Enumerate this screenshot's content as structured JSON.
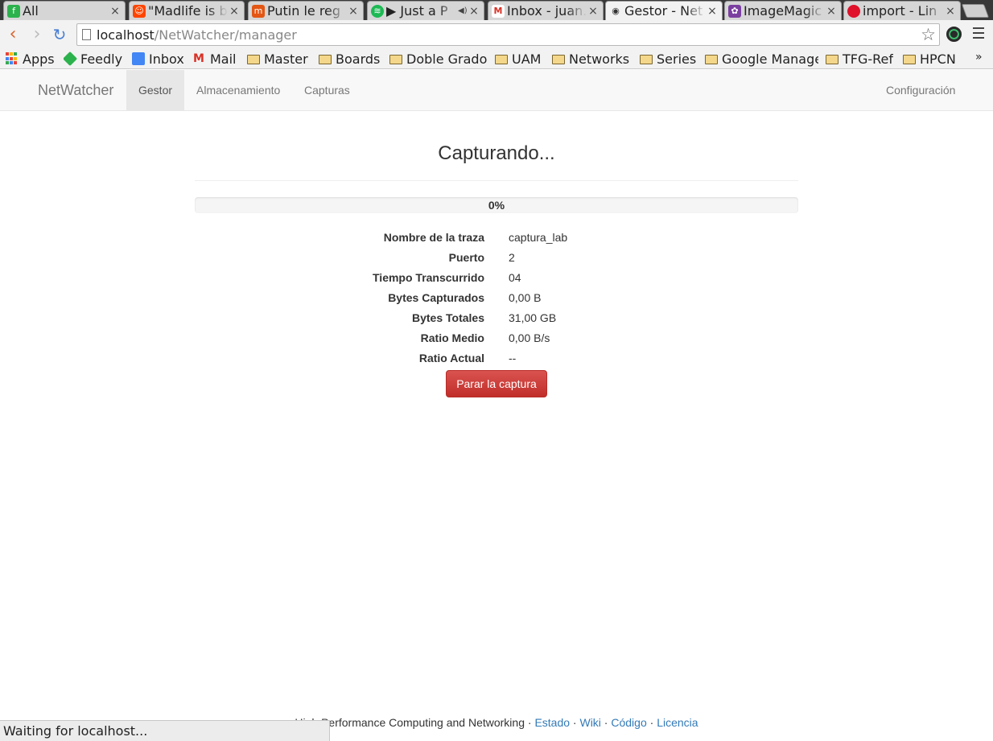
{
  "browser": {
    "tabs": [
      {
        "title": "All",
        "favicon": "feedly-icon",
        "color": "#2bb24c",
        "glyph": "f"
      },
      {
        "title": "\"Madlife is b",
        "favicon": "reddit-icon",
        "color": "#ff4500",
        "glyph": "☺"
      },
      {
        "title": "Putin le reg",
        "favicon": "meneame-icon",
        "color": "#e35614",
        "glyph": "m"
      },
      {
        "title": "▶ Just a P",
        "favicon": "spotify-icon",
        "color": "#1db954",
        "glyph": "≋"
      },
      {
        "title": "Inbox - juan.",
        "favicon": "gmail-icon",
        "color": "#d93025",
        "glyph": "M"
      },
      {
        "title": "Gestor - Net",
        "favicon": "eye-icon",
        "color": "#555555",
        "glyph": "◉"
      },
      {
        "title": "ImageMagic",
        "favicon": "imagemagick-icon",
        "color": "#7b3fa0",
        "glyph": "✿"
      },
      {
        "title": "import - Lin",
        "favicon": "manpage-icon",
        "color": "#e0112b",
        "glyph": "●"
      }
    ],
    "url_host": "localhost",
    "url_path": "/NetWatcher/manager",
    "bookmarks": [
      "Apps",
      "Feedly",
      "Inbox",
      "Mail",
      "Master",
      "Boards",
      "Doble Grado",
      "UAM",
      "Networks",
      "Series",
      "Google Manage",
      "TFG-Ref",
      "HPCN"
    ],
    "bookmarks_overflow": "»",
    "status": "Waiting for localhost..."
  },
  "nav": {
    "brand": "NetWatcher",
    "links": [
      "Gestor",
      "Almacenamiento",
      "Capturas"
    ],
    "active": "Gestor",
    "right_link": "Configuración"
  },
  "capture": {
    "title": "Capturando...",
    "progress_label": "0%",
    "progress_fraction": 0.0,
    "fields": [
      {
        "label": "Nombre de la traza",
        "value": "captura_lab"
      },
      {
        "label": "Puerto",
        "value": "2"
      },
      {
        "label": "Tiempo Transcurrido",
        "value": "04"
      },
      {
        "label": "Bytes Capturados",
        "value": "0,00 B"
      },
      {
        "label": "Bytes Totales",
        "value": "31,00 GB"
      },
      {
        "label": "Ratio Medio",
        "value": "0,00 B/s"
      },
      {
        "label": "Ratio Actual",
        "value": "--"
      }
    ],
    "stop_button": "Parar la captura"
  },
  "footer": {
    "text": "High Performance Computing and Networking · ",
    "links": [
      "Estado",
      "Wiki",
      "Código",
      "Licencia"
    ],
    "separator": " · "
  },
  "colors": {
    "accent": "#337ab7",
    "danger": "#d9534f"
  }
}
